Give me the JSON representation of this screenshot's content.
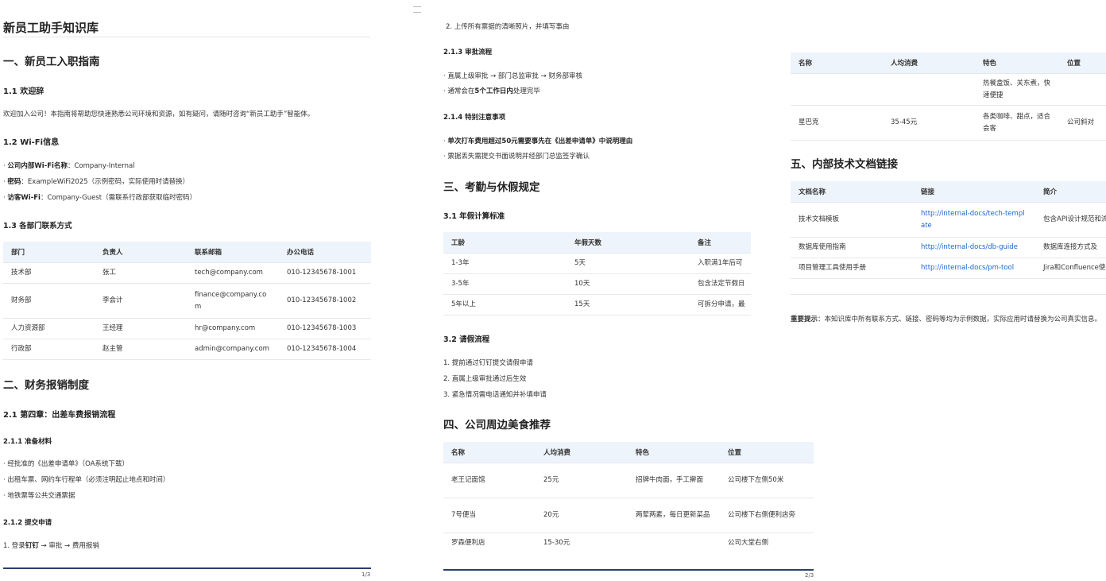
{
  "page1": {
    "title": "新员工助手知识库",
    "s1_title": "一、新员工入职指南",
    "s11_title": "1.1 欢迎辞",
    "s11_text": "欢迎加入公司！本指南将帮助您快速熟悉公司环境和资源，如有疑问，请随时咨询“新员工助手”智能体。",
    "s12_title": "1.2 Wi-Fi信息",
    "wifi": [
      {
        "label": "公司内部Wi-Fi名称",
        "value": "：Company-Internal"
      },
      {
        "label": "密码",
        "value": "：ExampleWiFi2025（示例密码，实际使用时请替换）"
      },
      {
        "label": "访客Wi-Fi",
        "value": "：Company-Guest（需联系行政部获取临时密码）"
      }
    ],
    "s13_title": "1.3 各部门联系方式",
    "contacts": {
      "headers": [
        "部门",
        "负责人",
        "联系邮箱",
        "办公电话"
      ],
      "rows": [
        [
          "技术部",
          "张工",
          "tech@company.com",
          "010-12345678-1001"
        ],
        [
          "财务部",
          "李会计",
          "finance@company.com",
          "010-12345678-1002"
        ],
        [
          "人力资源部",
          "王经理",
          "hr@company.com",
          "010-12345678-1003"
        ],
        [
          "行政部",
          "赵主管",
          "admin@company.com",
          "010-12345678-1004"
        ]
      ]
    },
    "s2_title": "二、财务报销制度",
    "s21_title": "2.1 第四章：出差车费报销流程",
    "s211_title": "2.1.1 准备材料",
    "materials": [
      "经批准的《出差申请单》（OA系统下载）",
      "出租车票、网约车行程单（必须注明起止地点和时间）",
      "地铁票等公共交通票据"
    ],
    "s212_title": "2.1.2 提交申请",
    "submit_prefix": "1. 登录",
    "submit_bold": "钉钉",
    "submit_suffix": " → 审批 → 费用报销",
    "page_num": "1/3"
  },
  "page2": {
    "submit_step2": "2. 上传所有票据的清晰照片，并填写事由",
    "s213_title": "2.1.3 审批流程",
    "approval": [
      "直属上级审批 → 部门总监审批 → 财务部审核"
    ],
    "approval2_prefix": "通常会在",
    "approval2_bold": "5个工作日内",
    "approval2_suffix": "处理完毕",
    "s214_title": "2.1.4 特别注意事项",
    "notice1": "单次打车费用超过50元需要事先在《出差申请单》中说明理由",
    "notice2": "票据丢失需提交书面说明并经部门总监签字确认",
    "s3_title": "三、考勤与休假规定",
    "s31_title": "3.1 年假计算标准",
    "leave": {
      "headers": [
        "工龄",
        "年假天数",
        "备注"
      ],
      "rows": [
        [
          "1-3年",
          "5天",
          "入职满1年后可"
        ],
        [
          "3-5年",
          "10天",
          "包含法定节假日"
        ],
        [
          "5年以上",
          "15天",
          "可拆分申请，最"
        ]
      ]
    },
    "s32_title": "3.2 请假流程",
    "leave_steps": [
      "1. 提前通过钉钉提交请假申请",
      "2. 直属上级审批通过后生效",
      "3. 紧急情况需电话通知并补填申请"
    ],
    "s4_title": "四、公司周边美食推荐",
    "food": {
      "headers": [
        "名称",
        "人均消费",
        "特色",
        "位置"
      ],
      "rows": [
        [
          "老王记面馆",
          "25元",
          "招牌牛肉面，手工擀面",
          "公司楼下左侧50米"
        ],
        [
          "7号便当",
          "20元",
          "两荤两素，每日更新菜品",
          "公司楼下右侧便利店旁"
        ],
        [
          "罗森便利店",
          "15-30元",
          "",
          "公司大堂右侧"
        ]
      ]
    },
    "page_num": "2/3"
  },
  "page3": {
    "food_cont": {
      "headers": [
        "名称",
        "人均消费",
        "特色",
        "位置"
      ],
      "rows": [
        [
          "",
          "",
          "热餐盒饭、关东煮，快速便捷",
          ""
        ],
        [
          "星巴克",
          "35-45元",
          "各类咖啡、甜点，适合会客",
          "公司斜对"
        ]
      ]
    },
    "s5_title": "五、内部技术文档链接",
    "docs": {
      "headers": [
        "文档名称",
        "链接",
        "简介"
      ],
      "rows": [
        [
          "技术文档模板",
          "http://internal-docs/tech-template",
          "包含API设计规范和流程"
        ],
        [
          "数据库使用指南",
          "http://internal-docs/db-guide",
          "数据库连接方式及"
        ],
        [
          "项目管理工具使用手册",
          "http://internal-docs/pm-tool",
          "Jira和Confluence使"
        ]
      ]
    },
    "tip_label": "重要提示",
    "tip_text": "：本知识库中所有联系方式、链接、密码等均为示例数据，实际应用时请替换为公司真实信息。"
  }
}
